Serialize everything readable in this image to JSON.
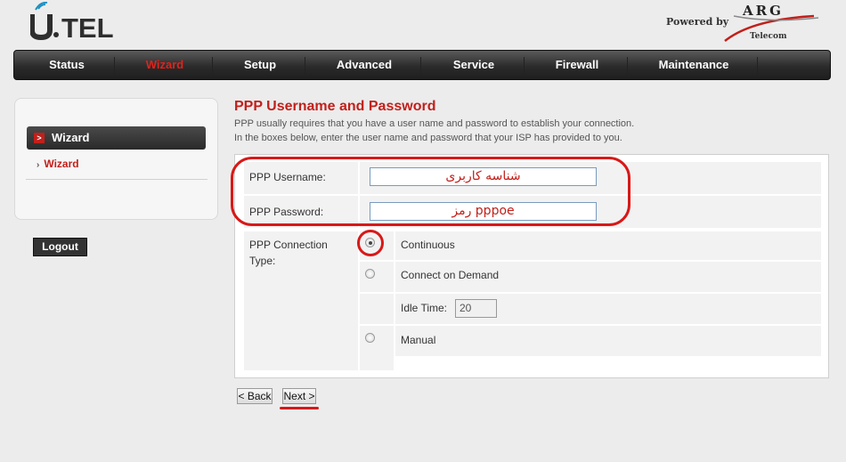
{
  "header": {
    "logo_text": "U.TEL",
    "brand_powered": "Powered by",
    "brand_name": "ARG",
    "brand_sub": "Telecom"
  },
  "nav": {
    "items": [
      {
        "label": "Status",
        "active": false
      },
      {
        "label": "Wizard",
        "active": true
      },
      {
        "label": "Setup",
        "active": false
      },
      {
        "label": "Advanced",
        "active": false
      },
      {
        "label": "Service",
        "active": false
      },
      {
        "label": "Firewall",
        "active": false
      },
      {
        "label": "Maintenance",
        "active": false
      }
    ]
  },
  "sidebar": {
    "header_badge": ">",
    "header": "Wizard",
    "link": "Wizard",
    "logout": "Logout"
  },
  "page": {
    "title": "PPP Username and Password",
    "desc_line1": "PPP usually requires that you have a user name and password to establish your connection.",
    "desc_line2": "In the boxes below, enter the user name and password that your ISP has provided to you."
  },
  "form": {
    "username_label": "PPP Username:",
    "username_value": "شناسه کاربری",
    "password_label": "PPP Password:",
    "password_value": "رمز pppoe",
    "conn_type_label_1": "PPP Connection",
    "conn_type_label_2": "Type:",
    "options": [
      {
        "label": "Continuous",
        "checked": true
      },
      {
        "label": "Connect on Demand",
        "checked": false
      },
      {
        "label": "Manual",
        "checked": false
      }
    ],
    "idle_label": "Idle Time:",
    "idle_value": "20"
  },
  "buttons": {
    "back": "< Back",
    "next": "Next >"
  },
  "colors": {
    "accent_red": "#c2201b",
    "annotation_red": "#d81818",
    "nav_bg": "#2b2b2b"
  }
}
